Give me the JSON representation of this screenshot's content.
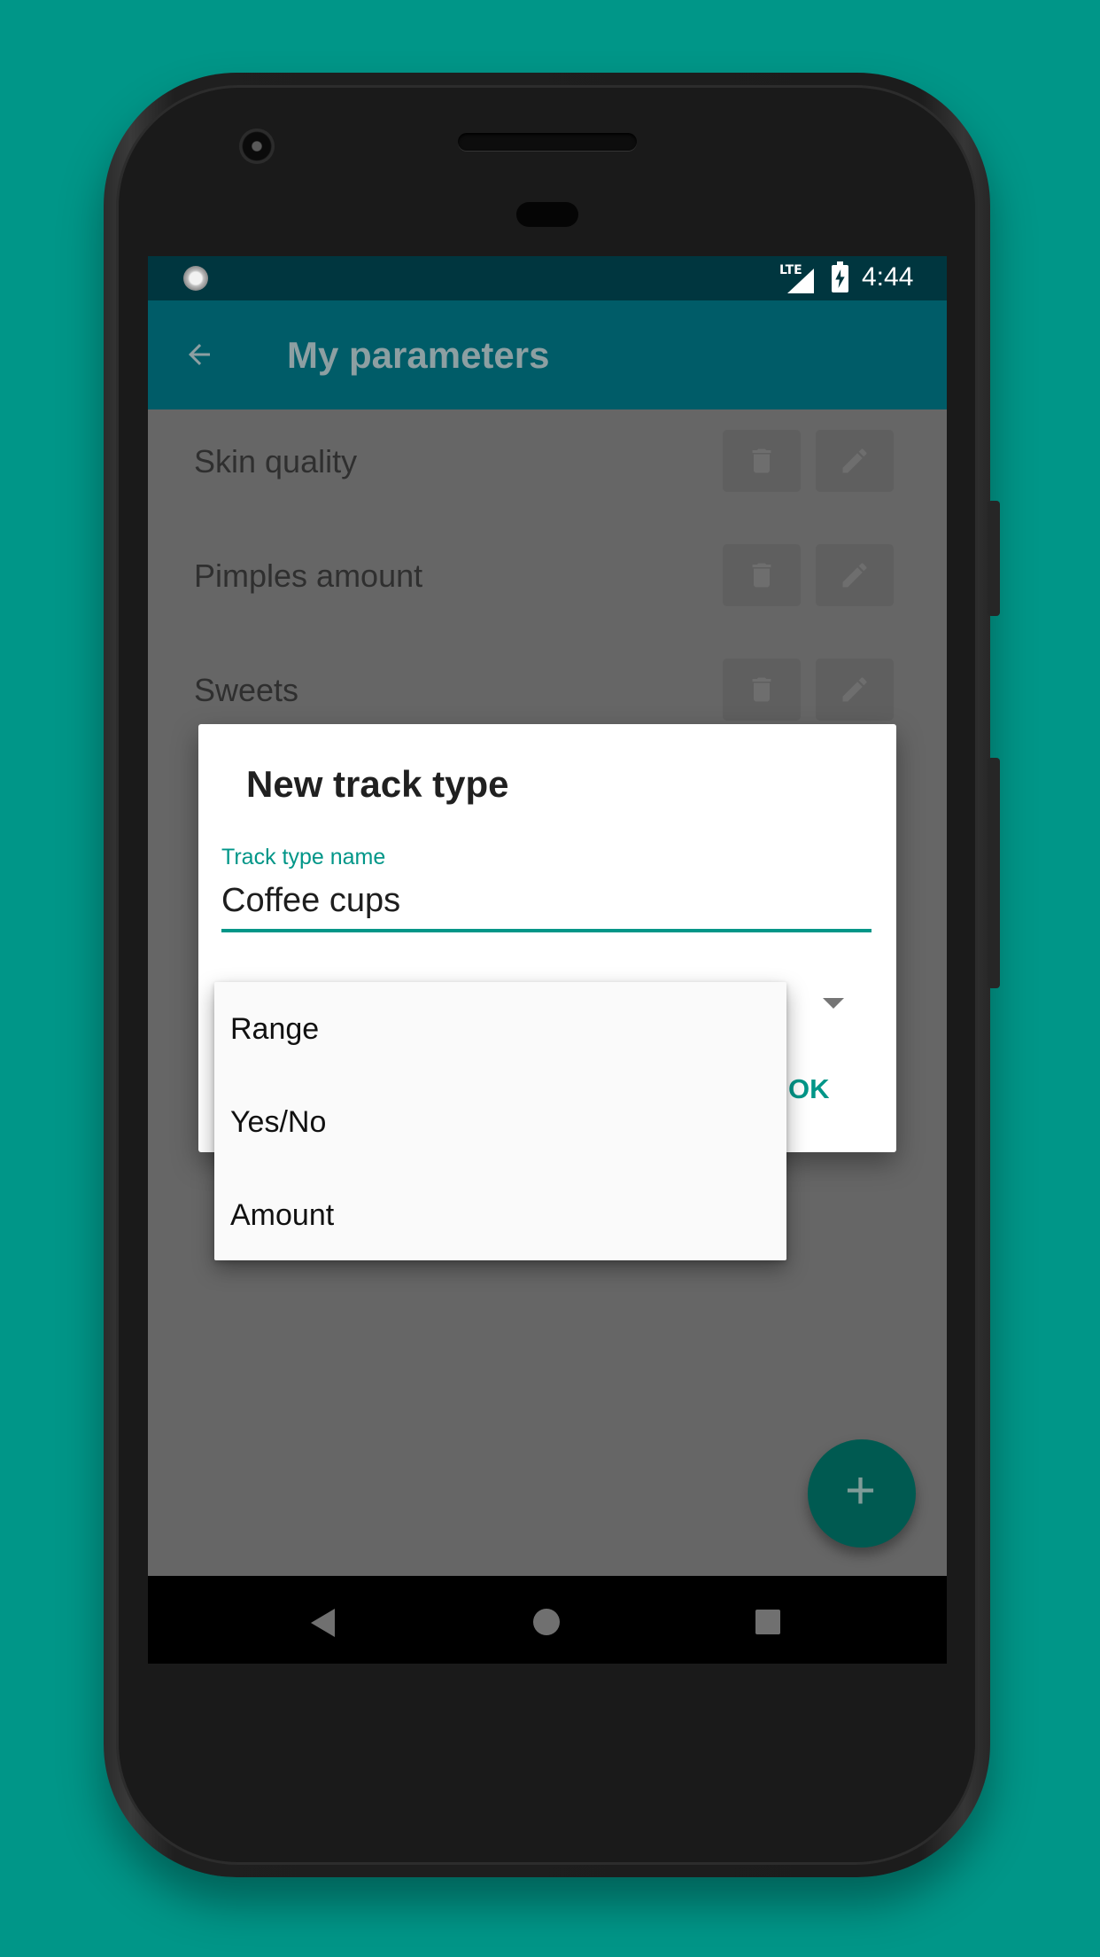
{
  "status_bar": {
    "network": "LTE",
    "time": "4:44"
  },
  "app_bar": {
    "title": "My parameters",
    "back_icon": "arrow-left-icon"
  },
  "parameters": [
    {
      "label": "Skin quality"
    },
    {
      "label": "Pimples amount"
    },
    {
      "label": "Sweets"
    }
  ],
  "dialog": {
    "title": "New track type",
    "field_label": "Track type name",
    "field_value": "Coffee cups",
    "ok_label": "OK"
  },
  "dropdown_menu": {
    "options": [
      "Range",
      "Yes/No",
      "Amount"
    ]
  },
  "fab": {
    "icon": "plus-icon"
  },
  "colors": {
    "background": "#009688",
    "accent": "#009688",
    "status_bar": "#00363f",
    "app_bar": "#005c68"
  }
}
